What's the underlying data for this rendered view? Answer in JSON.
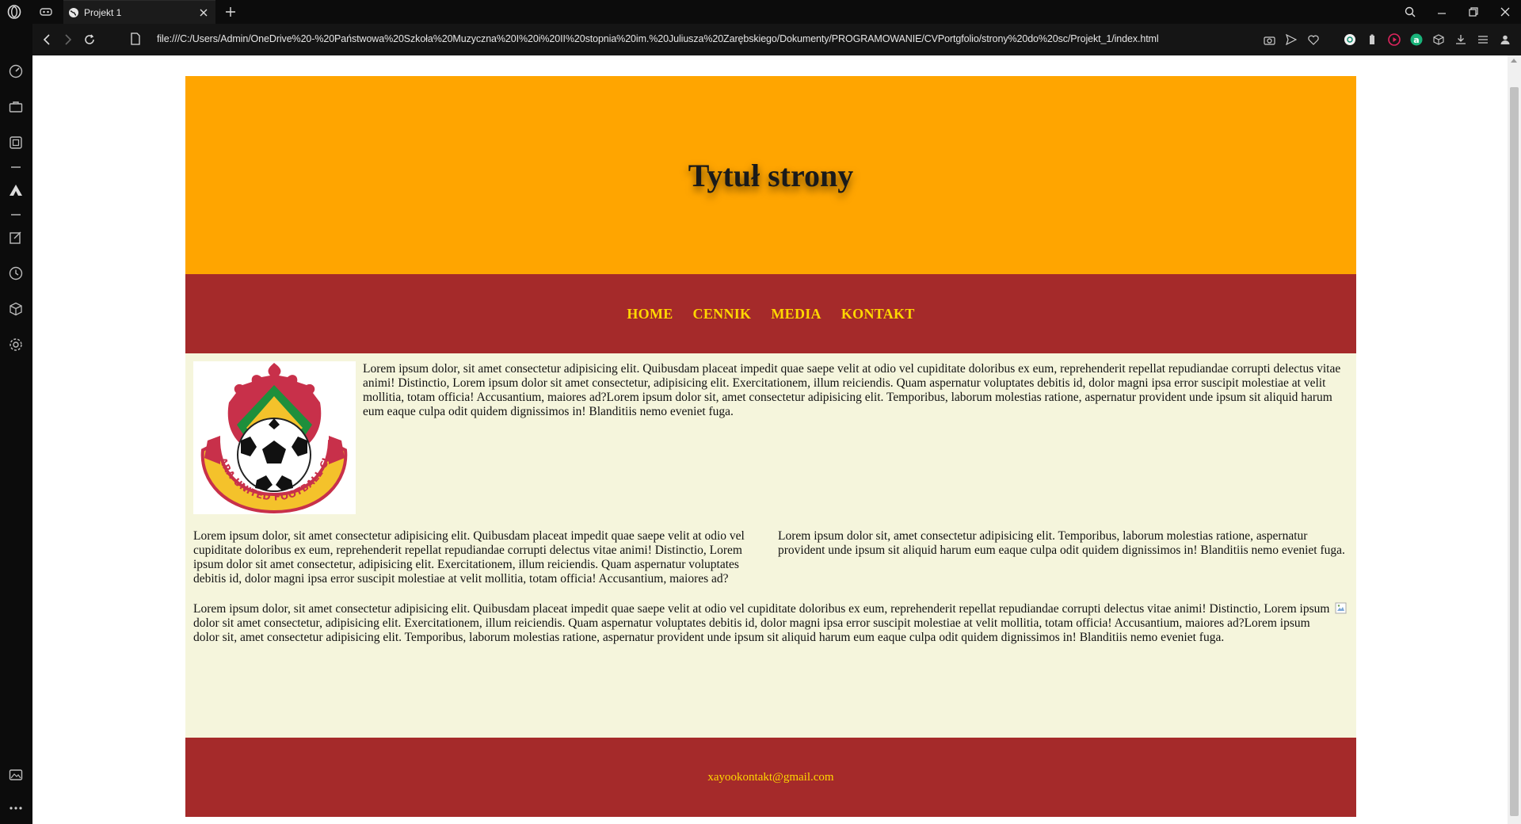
{
  "browser": {
    "tab_title": "Projekt 1",
    "url": "file:///C:/Users/Admin/OneDrive%20-%20Państwowa%20Szkoła%20Muzyczna%20I%20i%20II%20stopnia%20im.%20Juliusza%20Zarębskiego/Dokumenty/PROGRAMOWANIE/CVPortgfolio/strony%20do%20sc/Projekt_1/index.html"
  },
  "page": {
    "header_title": "Tytuł strony",
    "nav": [
      "HOME",
      "CENNIK",
      "MEDIA",
      "KONTAKT"
    ],
    "logo_text": "KWARA UNITED FOOTBALL CLUB",
    "paragraph1": "Lorem ipsum dolor, sit amet consectetur adipisicing elit. Quibusdam placeat impedit quae saepe velit at odio vel cupiditate doloribus ex eum, reprehenderit repellat repudiandae corrupti delectus vitae animi! Distinctio, Lorem ipsum dolor sit amet consectetur, adipisicing elit. Exercitationem, illum reiciendis. Quam aspernatur voluptates debitis id, dolor magni ipsa error suscipit molestiae at velit mollitia, totam officia! Accusantium, maiores ad?Lorem ipsum dolor sit, amet consectetur adipisicing elit. Temporibus, laborum molestias ratione, aspernatur provident unde ipsum sit aliquid harum eum eaque culpa odit quidem dignissimos in! Blanditiis nemo eveniet fuga.",
    "paragraph2": "Lorem ipsum dolor, sit amet consectetur adipisicing elit. Quibusdam placeat impedit quae saepe velit at odio vel cupiditate doloribus ex eum, reprehenderit repellat repudiandae corrupti delectus vitae animi! Distinctio, Lorem ipsum dolor sit amet consectetur, adipisicing elit. Exercitationem, illum reiciendis. Quam aspernatur voluptates debitis id, dolor magni ipsa error suscipit molestiae at velit mollitia, totam officia! Accusantium, maiores ad?",
    "paragraph3": "Lorem ipsum dolor sit, amet consectetur adipisicing elit. Temporibus, laborum molestias ratione, aspernatur provident unde ipsum sit aliquid harum eum eaque culpa odit quidem dignissimos in! Blanditiis nemo eveniet fuga.",
    "paragraph4": "Lorem ipsum dolor, sit amet consectetur adipisicing elit. Quibusdam placeat impedit quae saepe velit at odio vel cupiditate doloribus ex eum, reprehenderit repellat repudiandae corrupti delectus vitae animi! Distinctio, Lorem ipsum dolor sit amet consectetur, adipisicing elit. Exercitationem, illum reiciendis. Quam aspernatur voluptates debitis id, dolor magni ipsa error suscipit molestiae at velit mollitia, totam officia! Accusantium, maiores ad?Lorem ipsum dolor sit, amet consectetur adipisicing elit. Temporibus, laborum molestias ratione, aspernatur provident unde ipsum sit aliquid harum eum eaque culpa odit quidem dignissimos in! Blanditiis nemo eveniet fuga.",
    "footer_email": "xayookontakt@gmail.com"
  },
  "colors": {
    "header_bg": "#ffa500",
    "nav_bg": "#a52a2a",
    "content_bg": "#f5f5dc",
    "link_color": "#ffd700"
  },
  "icons": {
    "sidebar": [
      "speed-dial-icon",
      "briefcase-icon",
      "workspaces-icon",
      "aria-icon",
      "pinboard-icon",
      "history-icon",
      "extensions-icon",
      "settings-icon",
      "image-icon",
      "more-icon"
    ],
    "toolbar": [
      "camera-icon",
      "send-icon",
      "heart-icon",
      "chatgpt-icon",
      "battery-icon",
      "music-icon",
      "aria-a-icon",
      "cube-icon",
      "download-icon",
      "easy-setup-icon",
      "account-icon"
    ]
  }
}
